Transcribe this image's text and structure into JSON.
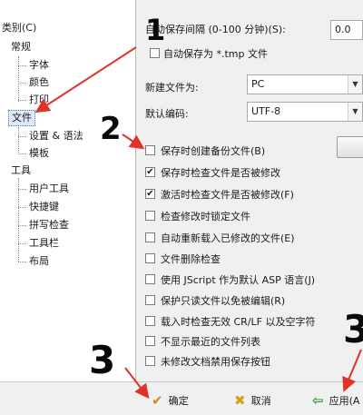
{
  "tree": {
    "title": "类别(C)",
    "items": [
      {
        "label": "常规"
      },
      {
        "label": "字体"
      },
      {
        "label": "颜色"
      },
      {
        "label": "打印"
      },
      {
        "label": "文件"
      },
      {
        "label": "设置 & 语法"
      },
      {
        "label": "模板"
      },
      {
        "label": "工具"
      },
      {
        "label": "用户工具"
      },
      {
        "label": "快捷键"
      },
      {
        "label": "拼写检查"
      },
      {
        "label": "工具栏"
      },
      {
        "label": "布局"
      }
    ]
  },
  "settings": {
    "autosave_interval_label": "自动保存间隔 (0-100 分钟)(S):",
    "autosave_interval_value": "0.0",
    "autosave_tmp_label": "自动保存为 *.tmp 文件",
    "new_file_label": "新建文件为:",
    "new_file_value": "PC",
    "default_encoding_label": "默认编码:",
    "default_encoding_value": "UTF-8",
    "checkboxes": [
      {
        "label": "保存时创建备份文件(B)",
        "checked": false
      },
      {
        "label": "保存时检查文件是否被修改",
        "checked": true
      },
      {
        "label": "激活时检查文件是否被修改(F)",
        "checked": true
      },
      {
        "label": "检查修改时锁定文件",
        "checked": false
      },
      {
        "label": "自动重新载入已修改的文件(E)",
        "checked": false
      },
      {
        "label": "文件删除检查",
        "checked": false
      },
      {
        "label": "使用 JScript 作为默认 ASP 语言(J)",
        "checked": false
      },
      {
        "label": "保护只读文件以免被编辑(R)",
        "checked": false
      },
      {
        "label": "载入时检查无效 CR/LF 以及空字符",
        "checked": false
      },
      {
        "label": "不显示最近的文件列表",
        "checked": false
      },
      {
        "label": "未修改文档禁用保存按钮",
        "checked": false
      }
    ]
  },
  "buttons": {
    "ok_label": "确定",
    "cancel_label": "取消",
    "apply_label": "应用(A"
  },
  "annotations": {
    "mark_1": "1",
    "mark_2": "2",
    "mark_3": "3",
    "mark_4": "3"
  },
  "colors": {
    "annotation_arrow": "#e0322a",
    "selection": "#dfe9f7",
    "ok_icon": "#d8861c",
    "cancel_icon": "#d4a21a",
    "apply_icon": "#2f9a2f"
  },
  "icons": {
    "ok": "check-icon",
    "cancel": "x-icon",
    "apply": "arrow-left-icon"
  }
}
